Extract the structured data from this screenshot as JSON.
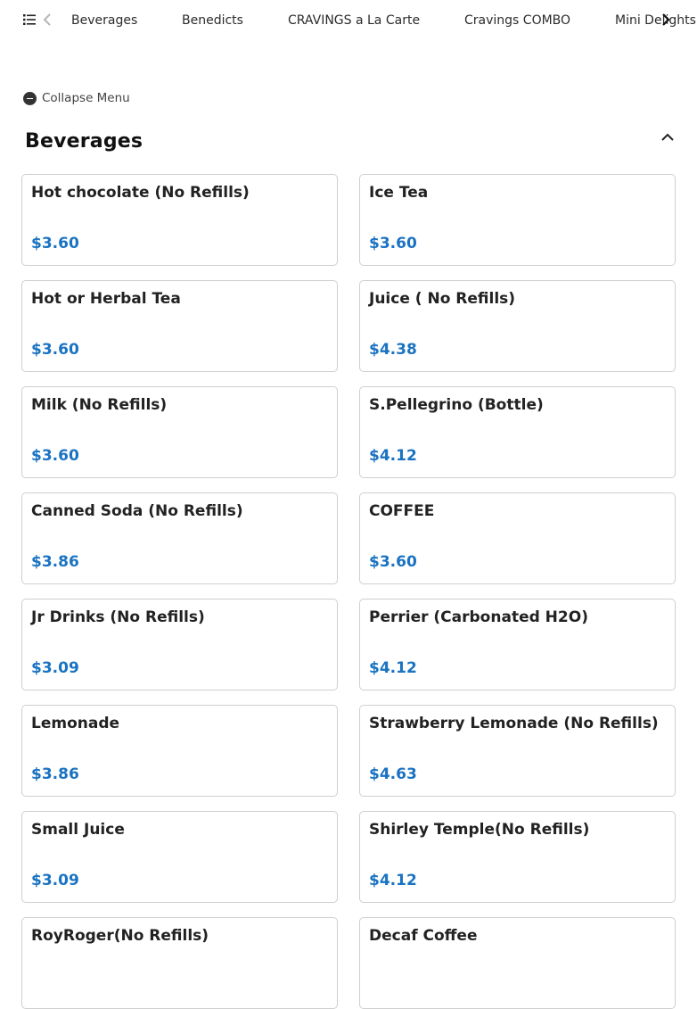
{
  "nav": {
    "tabs": [
      {
        "label": "Beverages"
      },
      {
        "label": "Benedicts"
      },
      {
        "label": "CRAVINGS a La Carte"
      },
      {
        "label": "Cravings COMBO"
      },
      {
        "label": "Mini Delights"
      }
    ],
    "icons": {
      "menu": "list-icon",
      "prev": "chevron-left-icon",
      "next": "chevron-right-icon"
    }
  },
  "collapse": {
    "label": "Collapse Menu",
    "icon": "minus-circle-icon"
  },
  "section": {
    "title": "Beverages",
    "toggle_icon": "chevron-up-icon"
  },
  "items": [
    {
      "name": "Hot chocolate (No Refills)",
      "price": "$3.60"
    },
    {
      "name": "Ice Tea",
      "price": "$3.60"
    },
    {
      "name": "Hot or Herbal Tea",
      "price": "$3.60"
    },
    {
      "name": "Juice ( No Refills)",
      "price": "$4.38"
    },
    {
      "name": "Milk (No Refills)",
      "price": "$3.60"
    },
    {
      "name": "S.Pellegrino (Bottle)",
      "price": "$4.12"
    },
    {
      "name": "Canned Soda (No Refills)",
      "price": "$3.86"
    },
    {
      "name": "COFFEE",
      "price": "$3.60"
    },
    {
      "name": "Jr Drinks (No Refills)",
      "price": "$3.09"
    },
    {
      "name": "Perrier (Carbonated H2O)",
      "price": "$4.12"
    },
    {
      "name": "Lemonade",
      "price": "$3.86"
    },
    {
      "name": "Strawberry Lemonade (No Refills)",
      "price": "$4.63"
    },
    {
      "name": "Small Juice",
      "price": "$3.09"
    },
    {
      "name": "Shirley Temple(No Refills)",
      "price": "$4.12"
    },
    {
      "name": "RoyRoger(No Refills)",
      "price": ""
    },
    {
      "name": "Decaf Coffee",
      "price": ""
    }
  ],
  "colors": {
    "price": "#1a73c2",
    "border": "#cfcfcf",
    "text": "#222222"
  }
}
